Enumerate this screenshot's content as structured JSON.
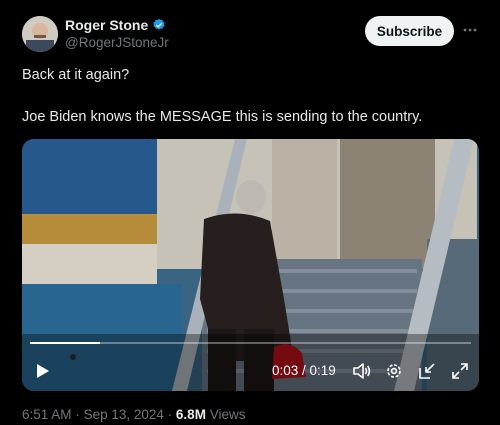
{
  "author": {
    "name": "Roger Stone",
    "handle": "@RogerJStoneJr",
    "verified_color": "#1d9bf0"
  },
  "actions": {
    "subscribe_label": "Subscribe",
    "more_icon": "more-horizontal-icon"
  },
  "tweet": {
    "line1": "Back at it again?",
    "line2": "Joe Biden knows the MESSAGE this is sending to the country."
  },
  "video": {
    "current_time": "0:03",
    "duration": "0:19",
    "time_display": "0:03 / 0:19",
    "progress": 0.158,
    "controls": [
      "play-icon",
      "volume-icon",
      "settings-icon",
      "pip-icon",
      "fullscreen-icon"
    ]
  },
  "meta": {
    "time": "6:51 AM",
    "date": "Sep 13, 2024",
    "separator": "·",
    "views_count": "6.8M",
    "views_label": "Views"
  }
}
